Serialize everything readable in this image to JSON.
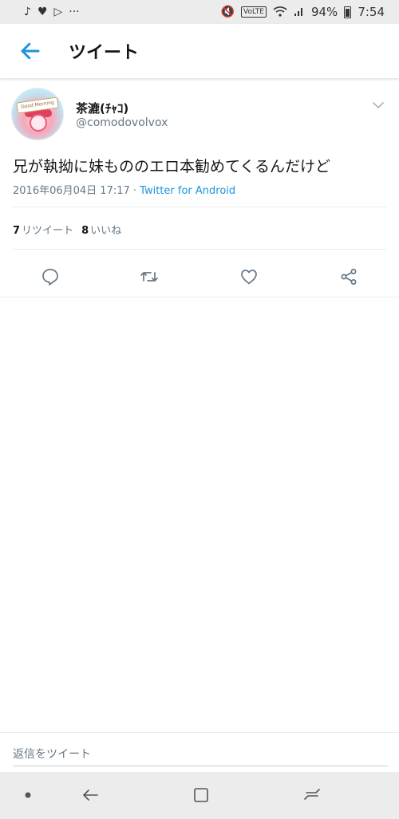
{
  "status_bar": {
    "battery_text": "94%",
    "time": "7:54",
    "volte": "VoLTE",
    "dots": "···"
  },
  "app_bar": {
    "title": "ツイート"
  },
  "tweet": {
    "display_name": "茶漉(ﾁｬｺ)",
    "username": "@comodovolvox",
    "avatar_sign": "Good Morning",
    "text": "兄が執拗に妹もののエロ本勧めてくるんだけど",
    "date": "2016年06月04日 17:17",
    "separator": " · ",
    "client": "Twitter for Android",
    "stats": {
      "retweet_count": "7",
      "retweet_label": "リツイート",
      "like_count": "8",
      "like_label": "いいね"
    }
  },
  "reply": {
    "placeholder": "返信をツイート"
  },
  "colors": {
    "accent": "#1b95e0",
    "text_primary": "#14171a",
    "text_secondary": "#657786"
  }
}
